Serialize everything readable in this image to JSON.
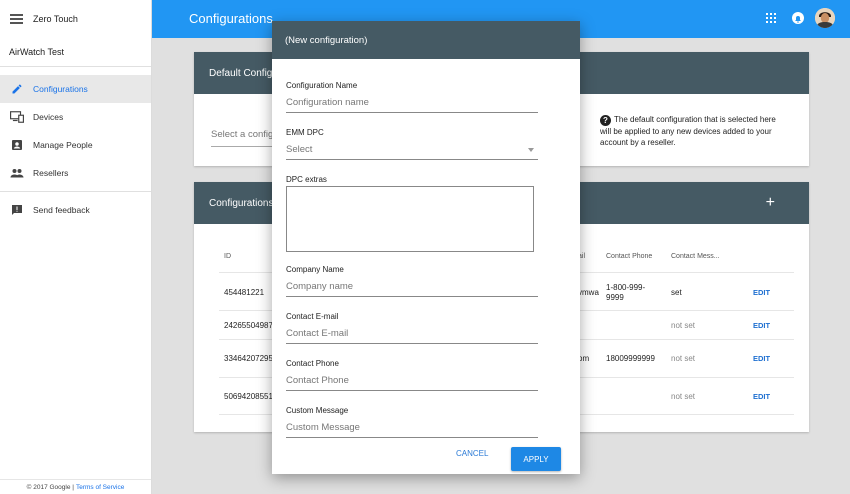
{
  "app": {
    "name": "Zero Touch",
    "org": "AirWatch Test"
  },
  "sidebar": {
    "items": [
      {
        "label": "Configurations",
        "icon": "pencil-icon",
        "active": true
      },
      {
        "label": "Devices",
        "icon": "devices-icon"
      },
      {
        "label": "Manage People",
        "icon": "contact-icon"
      },
      {
        "label": "Resellers",
        "icon": "people-icon"
      }
    ],
    "feedback": "Send feedback",
    "footer_copy": "© 2017 Google |",
    "footer_link": "Terms of Service"
  },
  "header": {
    "title": "Configurations"
  },
  "default_card": {
    "title": "Default Configu",
    "select_placeholder": "Select a config",
    "help_text": "The default configuration that is selected here will be applied to any new devices added to your account by a reseller."
  },
  "config_card": {
    "title": "Configurations",
    "columns": [
      "ID",
      "ail",
      "Contact Phone",
      "Contact Mess..."
    ],
    "rows": [
      {
        "id": "454481221",
        "email": "vmwa",
        "phone": "1-800-999-9999",
        "message": "set",
        "action": "EDIT"
      },
      {
        "id": "242655049873",
        "email": "",
        "phone": "",
        "message": "not set",
        "action": "EDIT"
      },
      {
        "id": "334642072950",
        "email": "om",
        "phone": "18009999999",
        "message": "not set",
        "action": "EDIT"
      },
      {
        "id": "506942085510",
        "email": "",
        "phone": "",
        "message": "not set",
        "action": "EDIT"
      }
    ]
  },
  "dialog": {
    "title": "(New configuration)",
    "fields": {
      "config_name": {
        "label": "Configuration Name",
        "placeholder": "Configuration name"
      },
      "emm_dpc": {
        "label": "EMM DPC",
        "placeholder": "Select"
      },
      "dpc_extras": {
        "label": "DPC extras"
      },
      "company_name": {
        "label": "Company Name",
        "placeholder": "Company name"
      },
      "contact_email": {
        "label": "Contact E-mail",
        "placeholder": "Contact E-mail"
      },
      "contact_phone": {
        "label": "Contact Phone",
        "placeholder": "Contact Phone"
      },
      "custom_message": {
        "label": "Custom Message",
        "placeholder": "Custom Message"
      }
    },
    "cancel": "CANCEL",
    "apply": "APPLY"
  },
  "colors": {
    "primary": "#2196f3",
    "header": "#455a64",
    "accent": "#1e88e5"
  }
}
